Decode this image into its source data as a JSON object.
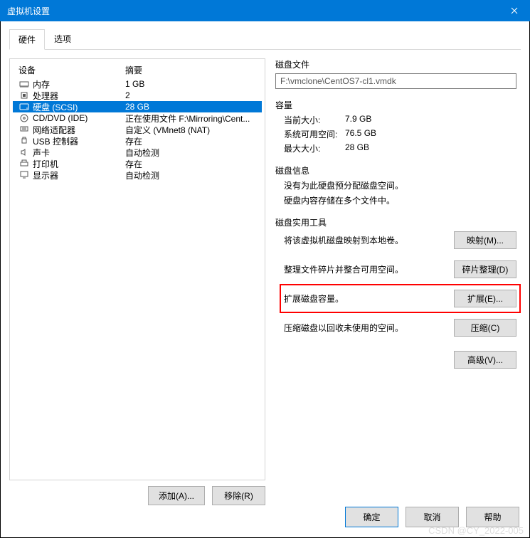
{
  "title": "虚拟机设置",
  "tabs": {
    "hardware": "硬件",
    "options": "选项"
  },
  "columns": {
    "device": "设备",
    "summary": "摘要"
  },
  "devices": [
    {
      "name": "内存",
      "summary": "1 GB"
    },
    {
      "name": "处理器",
      "summary": "2"
    },
    {
      "name": "硬盘 (SCSI)",
      "summary": "28 GB"
    },
    {
      "name": "CD/DVD (IDE)",
      "summary": "正在使用文件 F:\\Mirroring\\Cent..."
    },
    {
      "name": "网络适配器",
      "summary": "自定义 (VMnet8 (NAT)"
    },
    {
      "name": "USB 控制器",
      "summary": "存在"
    },
    {
      "name": "声卡",
      "summary": "自动检测"
    },
    {
      "name": "打印机",
      "summary": "存在"
    },
    {
      "name": "显示器",
      "summary": "自动检测"
    }
  ],
  "leftButtons": {
    "add": "添加(A)...",
    "remove": "移除(R)"
  },
  "right": {
    "diskFile": {
      "title": "磁盘文件",
      "path": "F:\\vmclone\\CentOS7-cl1.vmdk"
    },
    "capacity": {
      "title": "容量",
      "currentLabel": "当前大小:",
      "currentValue": "7.9 GB",
      "freeLabel": "系统可用空间:",
      "freeValue": "76.5 GB",
      "maxLabel": "最大大小:",
      "maxValue": "28 GB"
    },
    "diskInfo": {
      "title": "磁盘信息",
      "line1": "没有为此硬盘预分配磁盘空间。",
      "line2": "硬盘内容存储在多个文件中。"
    },
    "tools": {
      "title": "磁盘实用工具",
      "map": {
        "desc": "将该虚拟机磁盘映射到本地卷。",
        "btn": "映射(M)..."
      },
      "defrag": {
        "desc": "整理文件碎片并整合可用空间。",
        "btn": "碎片整理(D)"
      },
      "expand": {
        "desc": "扩展磁盘容量。",
        "btn": "扩展(E)..."
      },
      "compact": {
        "desc": "压缩磁盘以回收未使用的空间。",
        "btn": "压缩(C)"
      },
      "advanced": "高级(V)..."
    }
  },
  "footer": {
    "ok": "确定",
    "cancel": "取消",
    "help": "帮助"
  },
  "watermark": "CSDN @CY_2022-005"
}
